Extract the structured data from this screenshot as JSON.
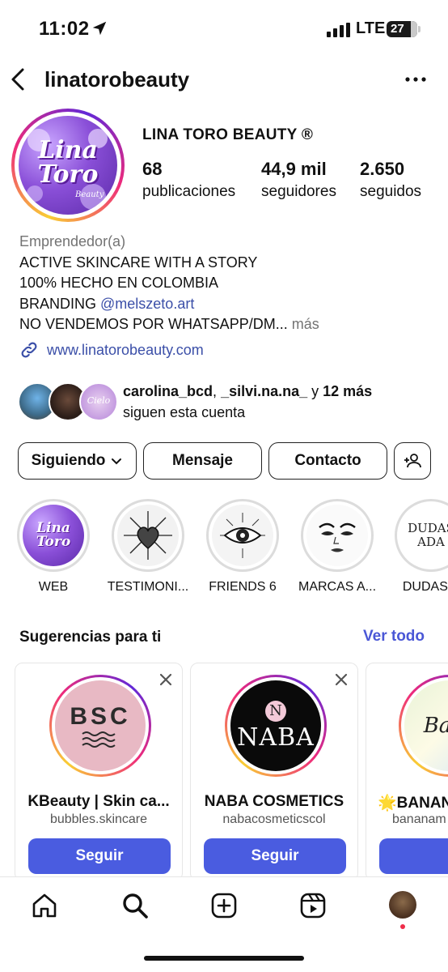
{
  "status": {
    "time": "11:02",
    "network": "LTE",
    "battery": "27"
  },
  "header": {
    "username": "linatorobeauty"
  },
  "profile": {
    "name": "LINA TORO BEAUTY ®",
    "avatar_text": "Lina Toro",
    "avatar_sub": "Beauty",
    "stats": [
      {
        "value": "68",
        "label": "publicaciones"
      },
      {
        "value": "44,9 mil",
        "label": "seguidores"
      },
      {
        "value": "2.650",
        "label": "seguidos"
      }
    ]
  },
  "bio": {
    "category": "Emprendedor(a)",
    "line1": "ACTIVE SKINCARE WITH A STORY",
    "line2": "100% HECHO EN COLOMBIA",
    "line3_prefix": "BRANDING ",
    "line3_mention": "@melszeto.art",
    "line4": "NO VENDEMOS POR WHATSAPP/DM...",
    "more": "más",
    "link": "www.linatorobeauty.com"
  },
  "followed_by": {
    "user1": "carolina_bcd",
    "sep": ", ",
    "user2": "_silvi.na.na_",
    "and": " y ",
    "others": "12 más",
    "suffix": "siguen esta cuenta",
    "mini3_text": "Cielo"
  },
  "actions": {
    "following": "Siguiendo",
    "message": "Mensaje",
    "contact": "Contacto"
  },
  "highlights": [
    {
      "label": "WEB"
    },
    {
      "label": "TESTIMONI..."
    },
    {
      "label": "FRIENDS 6"
    },
    {
      "label": "MARCAS A..."
    },
    {
      "label": "DUDAS A",
      "pic_text": "DUDAS ADA"
    }
  ],
  "suggestions": {
    "title": "Sugerencias para ti",
    "see_all": "Ver todo",
    "follow_label": "Seguir",
    "cards": [
      {
        "name": "KBeauty | Skin ca...",
        "handle": "bubbles.skincare",
        "logo": "BSC"
      },
      {
        "name": "NABA COSMETICS",
        "handle": "nabacosmeticscol",
        "logo": "NABA",
        "logo_mark": "N"
      },
      {
        "name": "🌟BANANA",
        "handle": "bananam",
        "logo": "Ba"
      }
    ]
  },
  "icons": {
    "back": "chevron-left-icon",
    "more": "more-horizontal-icon",
    "link": "link-icon",
    "home": "home-icon",
    "search": "search-icon",
    "create": "plus-square-icon",
    "reels": "reels-icon"
  },
  "colors": {
    "link": "#3b4fa8",
    "follow_button": "#4a5ce0",
    "see_all": "#4a57d6",
    "notification_dot": "#ef2d4a"
  }
}
